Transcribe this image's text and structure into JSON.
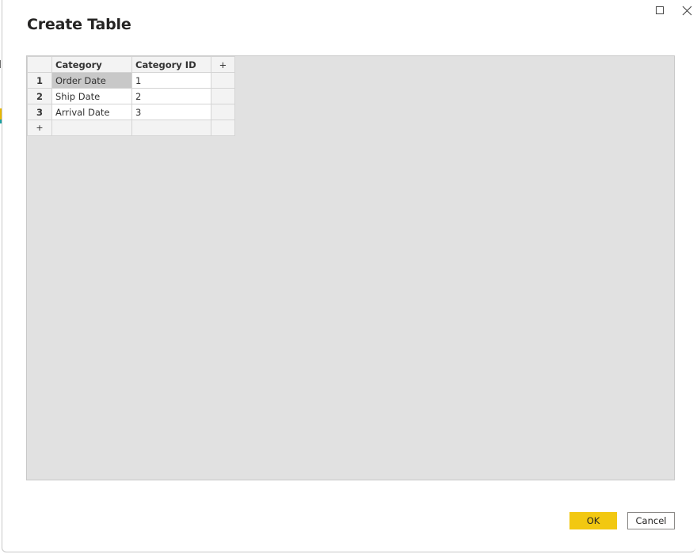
{
  "dialog": {
    "title": "Create Table",
    "window_controls": {
      "maximize_icon": "maximize-icon",
      "close_icon": "close-icon"
    }
  },
  "table": {
    "add_column_label": "+",
    "add_row_label": "+",
    "columns": [
      "Category",
      "Category ID"
    ],
    "rows": [
      {
        "number": "1",
        "cells": [
          "Order Date",
          "1"
        ]
      },
      {
        "number": "2",
        "cells": [
          "Ship Date",
          "2"
        ]
      },
      {
        "number": "3",
        "cells": [
          "Arrival Date",
          "3"
        ]
      }
    ],
    "selected_cell": {
      "row": 1,
      "column": "Category"
    }
  },
  "buttons": {
    "ok": "OK",
    "cancel": "Cancel"
  },
  "colors": {
    "accent": "#f2c811",
    "grid_background": "#e1e1e1",
    "selected_cell": "#c8c8c8"
  }
}
